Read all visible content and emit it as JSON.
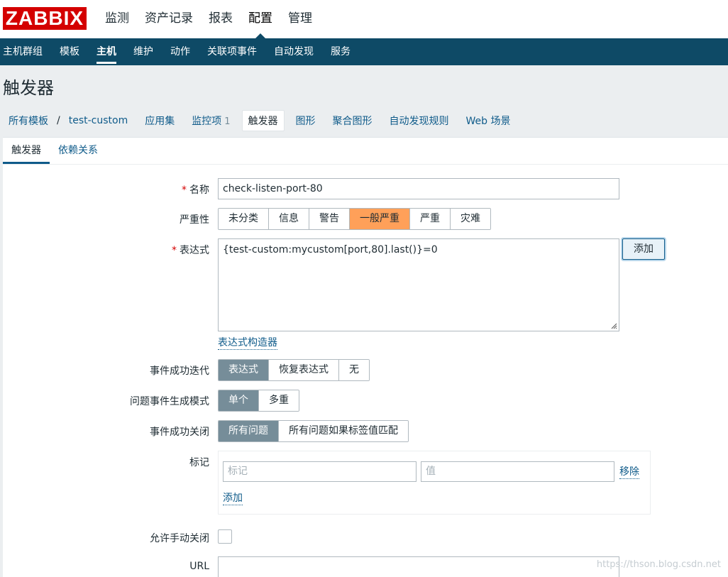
{
  "app": {
    "logo_text": "ZABBIX",
    "main_nav": [
      {
        "label": "监测"
      },
      {
        "label": "资产记录"
      },
      {
        "label": "报表"
      },
      {
        "label": "配置"
      },
      {
        "label": "管理"
      }
    ],
    "sub_nav": [
      {
        "label": "主机群组"
      },
      {
        "label": "模板"
      },
      {
        "label": "主机"
      },
      {
        "label": "维护"
      },
      {
        "label": "动作"
      },
      {
        "label": "关联项事件"
      },
      {
        "label": "自动发现"
      },
      {
        "label": "服务"
      }
    ]
  },
  "page": {
    "title": "触发器"
  },
  "breadcrumbs": {
    "all_templates": "所有模板",
    "separator": "/",
    "template": "test-custom",
    "applications": "应用集",
    "items": "监控项",
    "items_count": "1",
    "triggers": "触发器",
    "graphs": "图形",
    "screens": "聚合图形",
    "discovery": "自动发现规则",
    "web": "Web 场景"
  },
  "tabs": [
    {
      "label": "触发器"
    },
    {
      "label": "依赖关系"
    }
  ],
  "form": {
    "name": {
      "label": "名称",
      "value": "check-listen-port-80"
    },
    "severity": {
      "label": "严重性",
      "options": [
        "未分类",
        "信息",
        "警告",
        "一般严重",
        "严重",
        "灾难"
      ],
      "selected": "一般严重"
    },
    "expression": {
      "label": "表达式",
      "value": "{test-custom:mycustom[port,80].last()}=0",
      "add_button": "添加",
      "constructor_link": "表达式构造器"
    },
    "ok_event_generation": {
      "label": "事件成功迭代",
      "options": [
        "表达式",
        "恢复表达式",
        "无"
      ],
      "selected": "表达式"
    },
    "problem_mode": {
      "label": "问题事件生成模式",
      "options": [
        "单个",
        "多重"
      ],
      "selected": "单个"
    },
    "ok_event_close": {
      "label": "事件成功关闭",
      "options": [
        "所有问题",
        "所有问题如果标签值匹配"
      ],
      "selected": "所有问题"
    },
    "tags": {
      "label": "标记",
      "tag_placeholder": "标记",
      "value_placeholder": "值",
      "remove_link": "移除",
      "add_link": "添加"
    },
    "manual_close": {
      "label": "允许手动关闭",
      "checked": false
    },
    "url": {
      "label": "URL",
      "value": ""
    }
  },
  "watermark": "https://thson.blog.csdn.net",
  "colors": {
    "brand_red": "#d40000",
    "nav_blue": "#0e4a66",
    "link_blue": "#0f5b8a",
    "severity_average": "#ffa059",
    "segment_selected": "#768d99"
  }
}
